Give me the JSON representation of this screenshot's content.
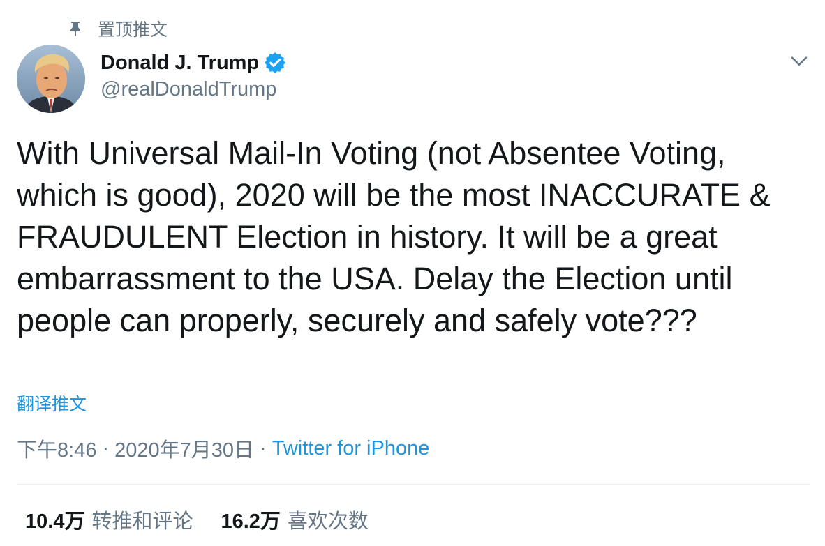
{
  "pinned": {
    "icon": "pin-icon",
    "label": "置顶推文"
  },
  "author": {
    "avatar": "avatar",
    "display_name": "Donald J. Trump",
    "verified_icon": "verified-badge-icon",
    "handle": "@realDonaldTrump"
  },
  "menu": {
    "icon": "chevron-down-icon"
  },
  "tweet": {
    "text": "With Universal Mail-In Voting (not Absentee Voting, which is good), 2020 will be the most INACCURATE & FRAUDULENT Election in history. It will be a great embarrassment to the USA. Delay the Election until people can properly, securely and safely vote???",
    "translate_label": "翻译推文"
  },
  "meta": {
    "time": "下午8:46",
    "separator": "·",
    "date": "2020年7月30日",
    "source": "Twitter for iPhone"
  },
  "stats": {
    "retweets_count": "10.4万",
    "retweets_label": "转推和评论",
    "likes_count": "16.2万",
    "likes_label": "喜欢次数"
  },
  "colors": {
    "link": "#1b95e0",
    "secondary_text": "#657786",
    "primary_text": "#14171a",
    "verified": "#1da1f2",
    "divider": "#e6ecf0"
  }
}
